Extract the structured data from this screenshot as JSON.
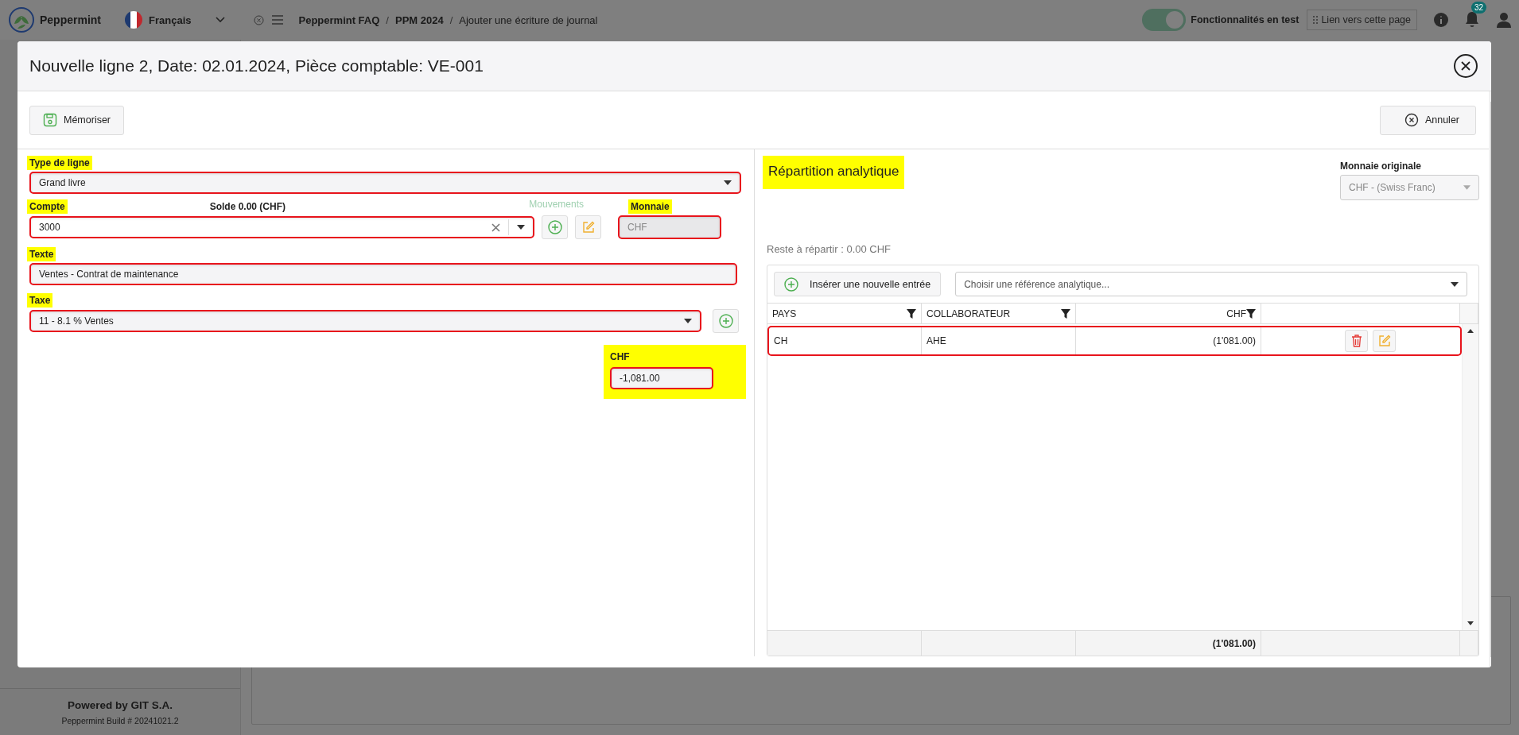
{
  "app_bar": {
    "app_name": "Peppermint",
    "language": "Français",
    "breadcrumb": [
      "Peppermint FAQ",
      "PPM 2024",
      "Ajouter une écriture de journal"
    ],
    "breadcrumb_separator": "/",
    "test_features": {
      "label": "Fonctionnalités en test",
      "on": true
    },
    "page_link": "Lien vers cette page",
    "notifications": "32"
  },
  "sidebar_footer": {
    "powered_by": "Powered by GIT S.A.",
    "build": "Peppermint Build # 20241021.2"
  },
  "dialog": {
    "title": "Nouvelle ligne 2, Date: 02.01.2024, Pièce comptable: VE-001",
    "save_button": "Mémoriser",
    "cancel_button": "Annuler",
    "form": {
      "line_type": {
        "label": "Type de ligne",
        "value": "Grand livre",
        "annotated": true
      },
      "account": {
        "label": "Compte",
        "value": "3000",
        "annotated": true
      },
      "balance": "Solde 0.00 (CHF)",
      "movements_link": "Mouvements",
      "currency": {
        "label": "Monnaie",
        "value": "CHF",
        "disabled": true,
        "annotated": true
      },
      "text": {
        "label": "Texte",
        "value": "Ventes - Contrat de maintenance",
        "annotated": true
      },
      "tax": {
        "label": "Taxe",
        "value": "11 - 8.1 % Ventes",
        "annotated": true
      },
      "amount": {
        "label": "CHF",
        "value": "-1,081.00",
        "annotated": true
      }
    },
    "analytics": {
      "title": "Répartition analytique",
      "title_annotated": true,
      "original_currency": {
        "label": "Monnaie originale",
        "value": "CHF - (Swiss Franc)",
        "disabled": true
      },
      "remaining": "Reste à répartir : 0.00 CHF",
      "insert_button": "Insérer une nouvelle entrée",
      "reference_placeholder": "Choisir une référence analytique...",
      "columns": [
        "PAYS",
        "COLLABORATEUR",
        "CHF"
      ],
      "rows": [
        {
          "cells": [
            "CH",
            "AHE",
            "(1'081.00)"
          ],
          "annotated": true
        }
      ],
      "total": "(1'081.00)"
    }
  }
}
